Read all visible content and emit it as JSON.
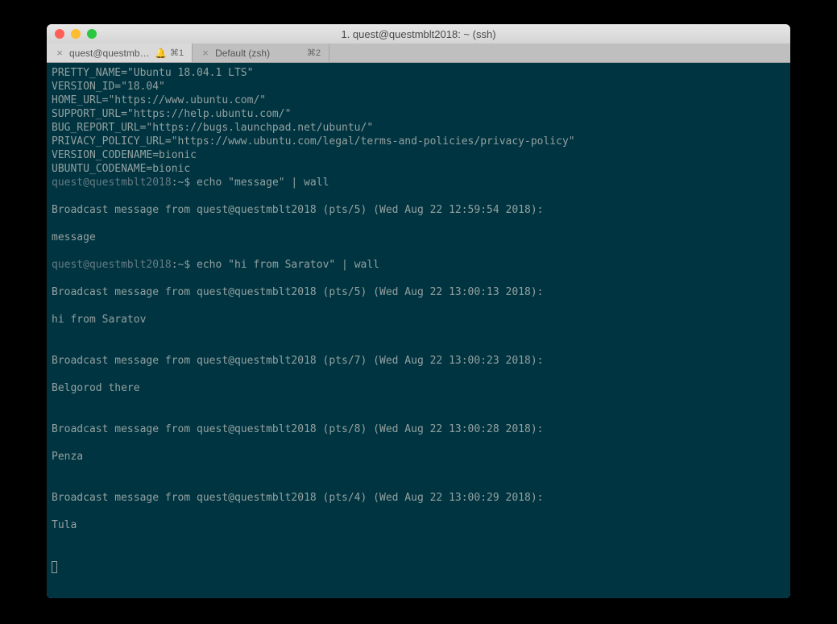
{
  "title": "1. quest@questmblt2018: ~ (ssh)",
  "tabs": [
    {
      "label": "quest@questmblt...",
      "shortcut": "⌘1",
      "hasBell": true,
      "active": true
    },
    {
      "label": "Default (zsh)",
      "shortcut": "⌘2",
      "hasBell": false,
      "active": false
    }
  ],
  "colors": {
    "terminalBg": "#003440",
    "terminalFg": "#93a1a1",
    "promptUser": "#657b83"
  },
  "osRelease": [
    "PRETTY_NAME=\"Ubuntu 18.04.1 LTS\"",
    "VERSION_ID=\"18.04\"",
    "HOME_URL=\"https://www.ubuntu.com/\"",
    "SUPPORT_URL=\"https://help.ubuntu.com/\"",
    "BUG_REPORT_URL=\"https://bugs.launchpad.net/ubuntu/\"",
    "PRIVACY_POLICY_URL=\"https://www.ubuntu.com/legal/terms-and-policies/privacy-policy\"",
    "VERSION_CODENAME=bionic",
    "UBUNTU_CODENAME=bionic"
  ],
  "prompt": {
    "user": "quest@questmblt2018",
    "path": ":~$ "
  },
  "commands": [
    {
      "cmd": "echo \"message\" | wall",
      "broadcasts": [
        {
          "header": "Broadcast message from quest@questmblt2018 (pts/5) (Wed Aug 22 12:59:54 2018):",
          "body": "message"
        }
      ]
    },
    {
      "cmd": "echo \"hi from Saratov\" | wall",
      "broadcasts": [
        {
          "header": "Broadcast message from quest@questmblt2018 (pts/5) (Wed Aug 22 13:00:13 2018):",
          "body": "hi from Saratov"
        },
        {
          "header": "Broadcast message from quest@questmblt2018 (pts/7) (Wed Aug 22 13:00:23 2018):",
          "body": "Belgorod there"
        },
        {
          "header": "Broadcast message from quest@questmblt2018 (pts/8) (Wed Aug 22 13:00:28 2018):",
          "body": "Penza"
        },
        {
          "header": "Broadcast message from quest@questmblt2018 (pts/4) (Wed Aug 22 13:00:29 2018):",
          "body": "Tula"
        }
      ]
    }
  ]
}
